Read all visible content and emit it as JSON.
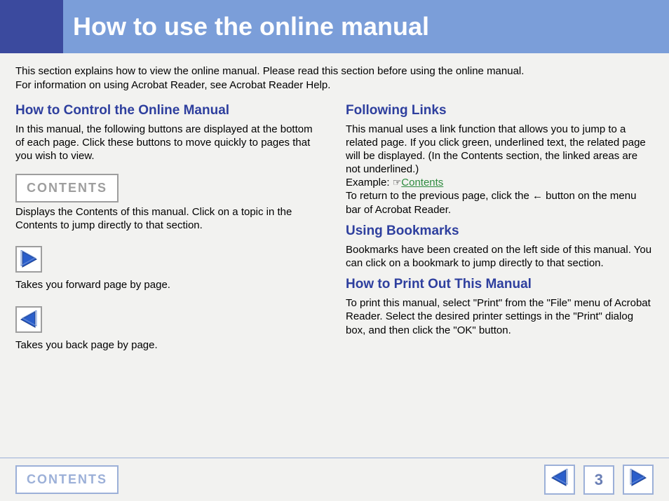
{
  "header": {
    "title": "How to use the online manual"
  },
  "intro": {
    "line1": "This section explains how to view the online manual. Please read this section before using the online manual.",
    "line2": "For information on using Acrobat Reader, see Acrobat Reader Help."
  },
  "left": {
    "h1": "How to Control the Online Manual",
    "p1": "In this manual, the following buttons are displayed at the bottom of each page. Click these buttons to move quickly to pages that you wish to view.",
    "contents_label": "CONTENTS",
    "contents_desc": "Displays the Contents of this manual. Click on a topic in the Contents to jump directly to that section.",
    "forward_desc": "Takes you forward page by page.",
    "back_desc": "Takes you back page by page."
  },
  "right": {
    "h1": "Following Links",
    "p1a": "This manual uses a link function that allows you to jump to a related page. If you click green, underlined text, the related page will be displayed. (In the Contents section, the linked areas are not underlined.)",
    "example_label": "Example: ",
    "example_link": "Contents",
    "p1b_a": "To return to the previous page, click the ",
    "p1b_b": " button on the menu bar of Acrobat Reader.",
    "h2": "Using Bookmarks",
    "p2": "Bookmarks have been created on the left side of this manual. You can click on a bookmark to jump directly to that section.",
    "h3": "How to Print Out This Manual",
    "p3": "To print this manual, select \"Print\" from the \"File\" menu of Acrobat Reader. Select the desired printer settings in the \"Print\" dialog box, and then click the \"OK\" button."
  },
  "footer": {
    "contents_label": "CONTENTS",
    "page_number": "3"
  }
}
